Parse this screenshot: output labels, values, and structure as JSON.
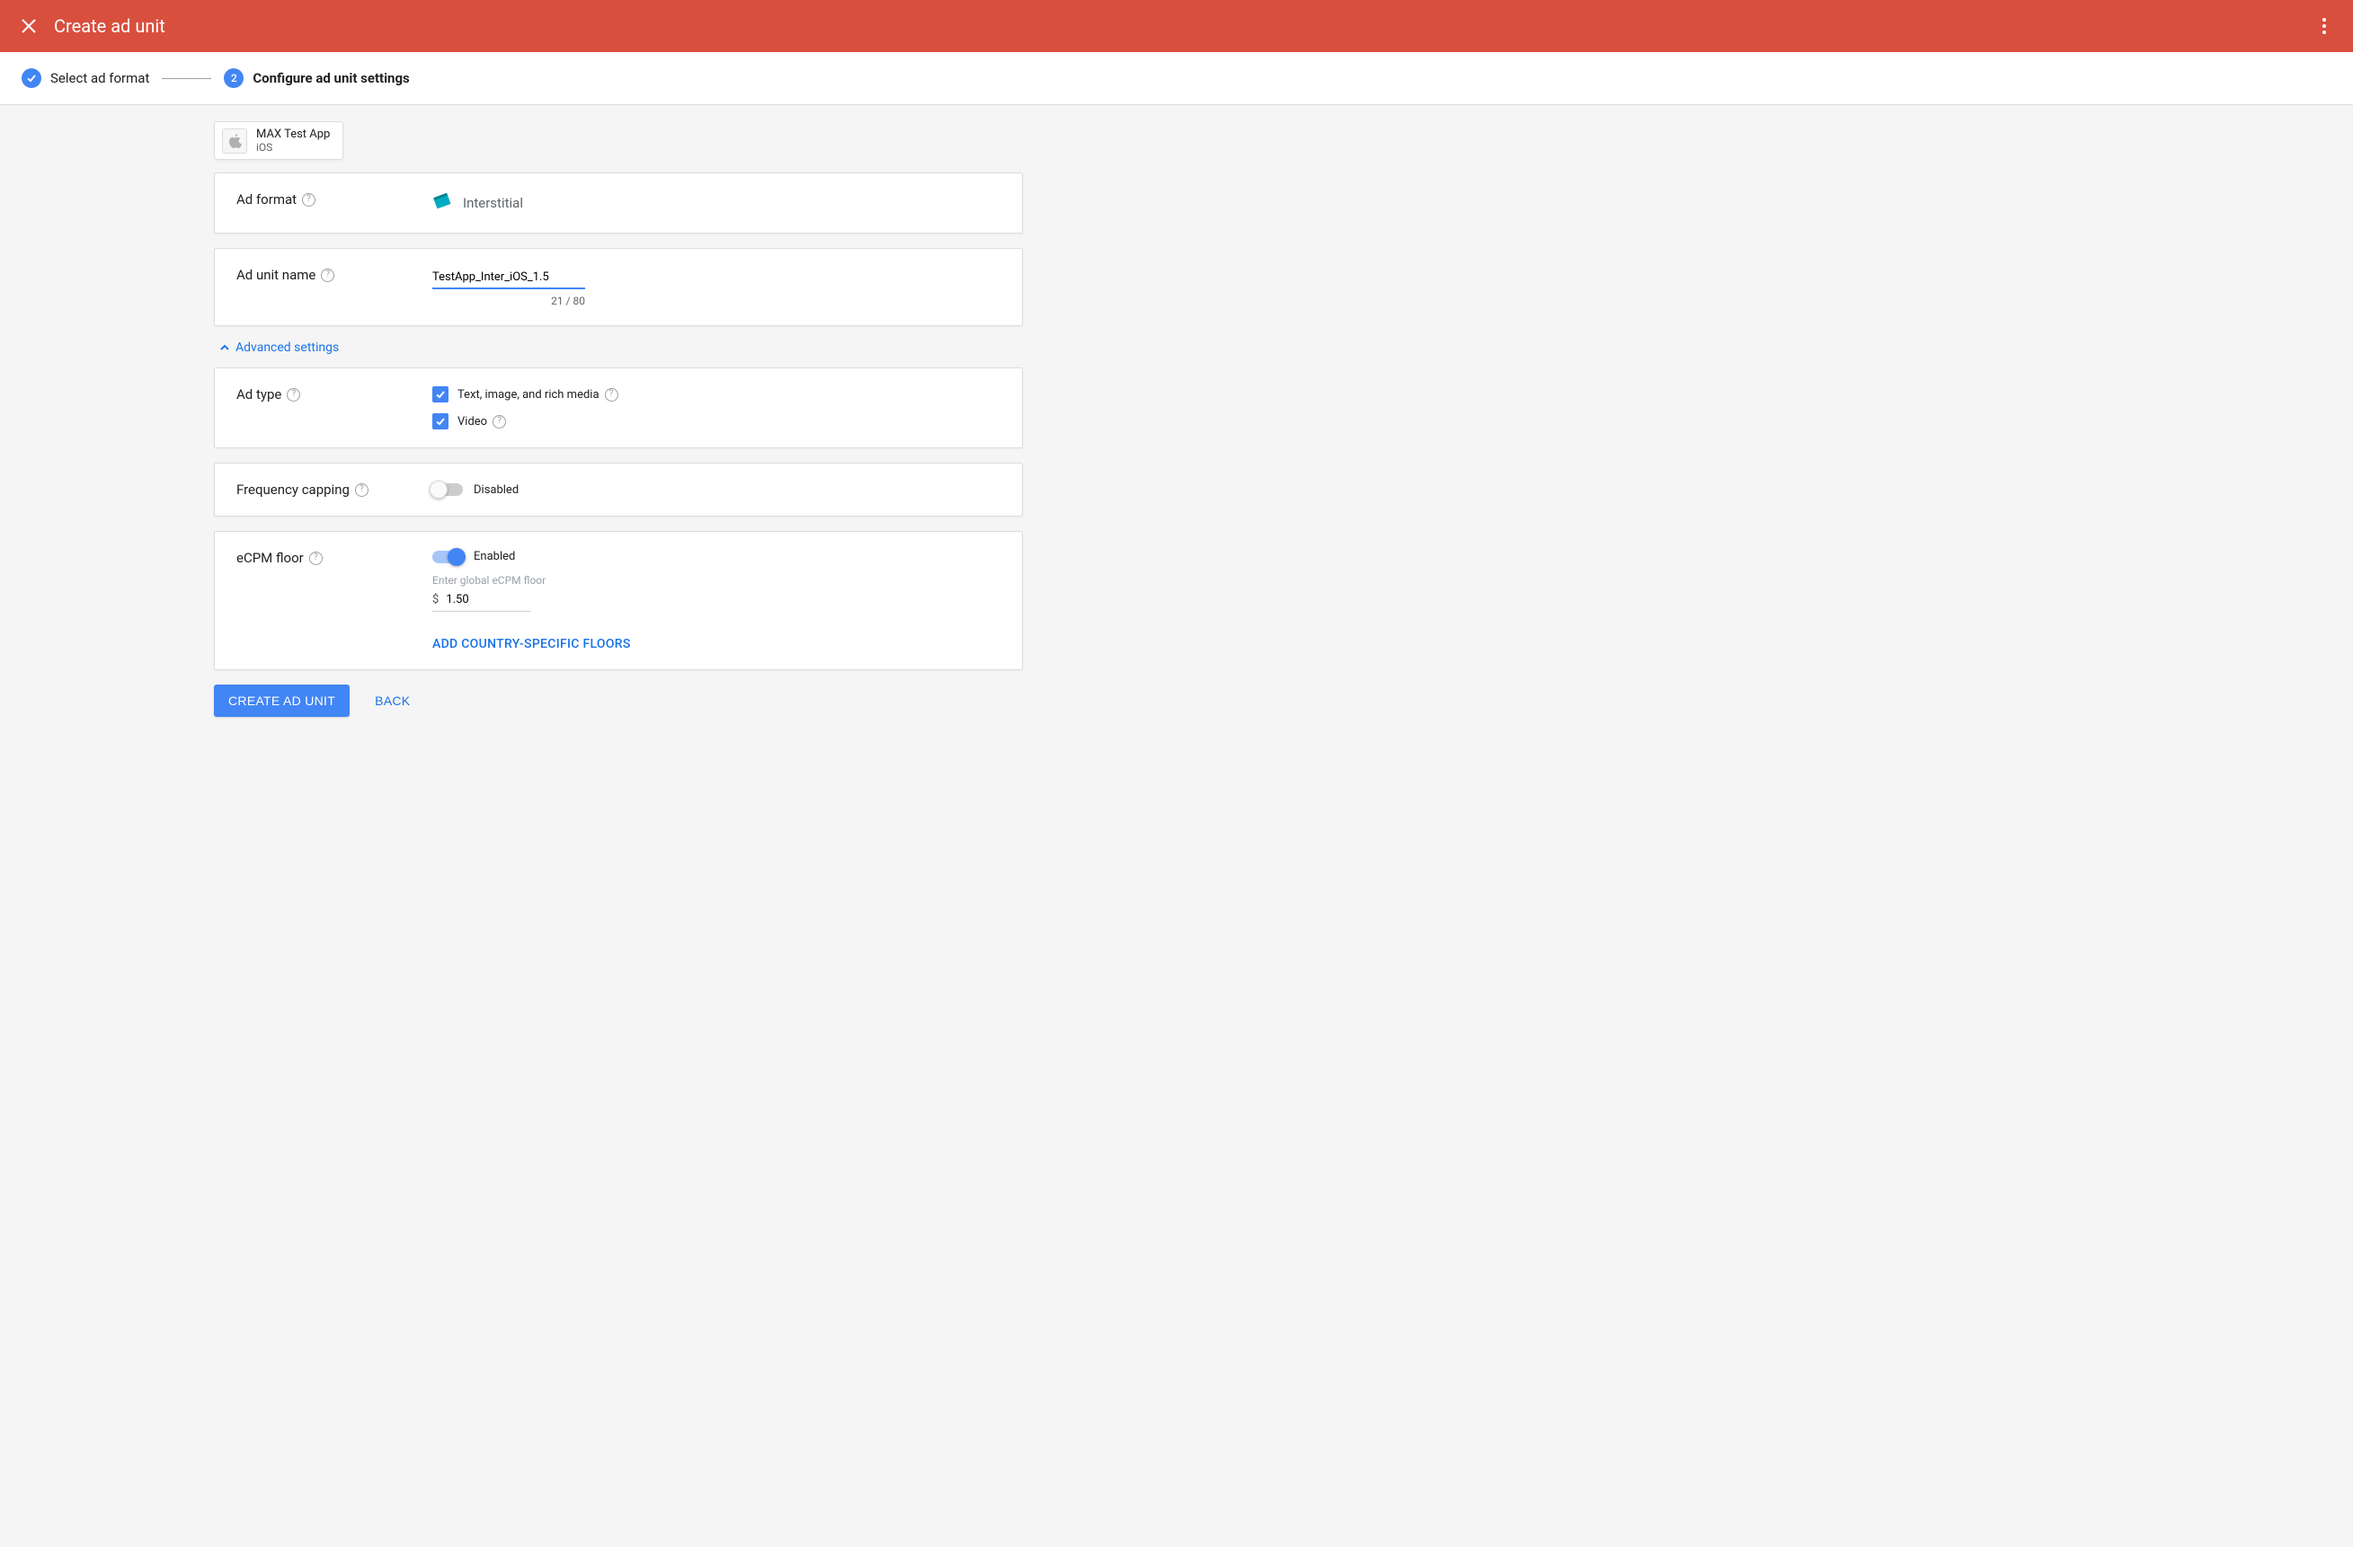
{
  "header": {
    "title": "Create ad unit"
  },
  "stepper": {
    "step1_label": "Select ad format",
    "step2_number": "2",
    "step2_label": "Configure ad unit settings"
  },
  "app": {
    "name": "MAX Test App",
    "platform": "iOS"
  },
  "ad_format": {
    "label": "Ad format",
    "value": "Interstitial"
  },
  "ad_unit_name": {
    "label": "Ad unit name",
    "value": "TestApp_Inter_iOS_1.5",
    "counter": "21 / 80"
  },
  "advanced": {
    "link": "Advanced settings"
  },
  "ad_type": {
    "label": "Ad type",
    "options": {
      "text_media": "Text, image, and rich media",
      "video": "Video"
    }
  },
  "freq_cap": {
    "label": "Frequency capping",
    "status": "Disabled"
  },
  "ecpm": {
    "label": "eCPM floor",
    "status": "Enabled",
    "hint": "Enter global eCPM floor",
    "currency": "$",
    "value": "1.50",
    "add_link": "ADD COUNTRY-SPECIFIC FLOORS"
  },
  "footer": {
    "create": "CREATE AD UNIT",
    "back": "BACK"
  }
}
